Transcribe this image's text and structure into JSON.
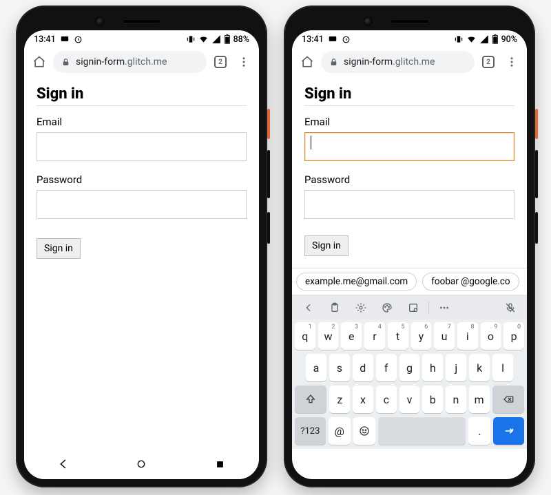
{
  "left": {
    "status": {
      "time": "13:41",
      "battery": "88%"
    },
    "browser": {
      "host": "signin-form",
      "path": ".glitch.me",
      "tab_count": "2"
    },
    "page": {
      "heading": "Sign in",
      "email_label": "Email",
      "email_value": "",
      "password_label": "Password",
      "password_value": "",
      "submit_label": "Sign in"
    }
  },
  "right": {
    "status": {
      "time": "13:41",
      "battery": "90%"
    },
    "browser": {
      "host": "signin-form",
      "path": ".glitch.me",
      "tab_count": "2"
    },
    "page": {
      "heading": "Sign in",
      "email_label": "Email",
      "email_value": "",
      "password_label": "Password",
      "password_value": "",
      "submit_label": "Sign in"
    },
    "suggestions": [
      "example.me@gmail.com",
      "foobar @google.co"
    ],
    "keyboard": {
      "row1": [
        {
          "main": "q",
          "sup": "1"
        },
        {
          "main": "w",
          "sup": "2"
        },
        {
          "main": "e",
          "sup": "3"
        },
        {
          "main": "r",
          "sup": "4"
        },
        {
          "main": "t",
          "sup": "5"
        },
        {
          "main": "y",
          "sup": "6"
        },
        {
          "main": "u",
          "sup": "7"
        },
        {
          "main": "i",
          "sup": "8"
        },
        {
          "main": "o",
          "sup": "9"
        },
        {
          "main": "p",
          "sup": "0"
        }
      ],
      "row2": [
        {
          "main": "a"
        },
        {
          "main": "s"
        },
        {
          "main": "d"
        },
        {
          "main": "f"
        },
        {
          "main": "g"
        },
        {
          "main": "h"
        },
        {
          "main": "j"
        },
        {
          "main": "k"
        },
        {
          "main": "l"
        }
      ],
      "row3": [
        {
          "main": "z"
        },
        {
          "main": "x"
        },
        {
          "main": "c"
        },
        {
          "main": "v"
        },
        {
          "main": "b"
        },
        {
          "main": "n"
        },
        {
          "main": "m"
        }
      ],
      "symbols_key": "?123",
      "at_key": "@",
      "period_key": "."
    }
  }
}
